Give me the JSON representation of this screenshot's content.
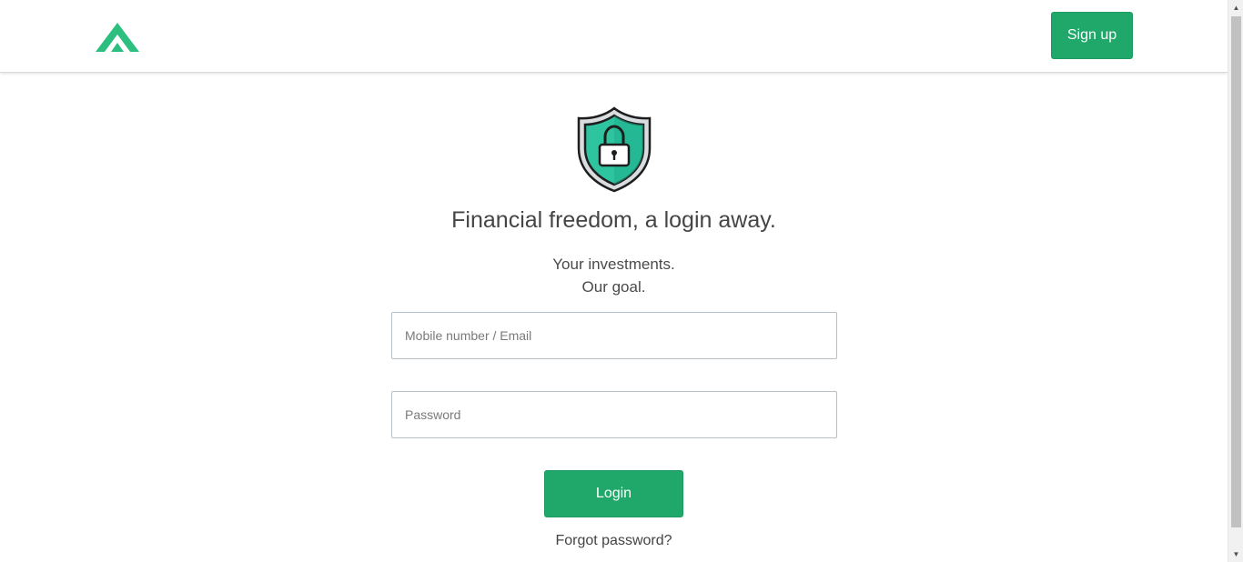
{
  "header": {
    "logo_icon": "mountain-chevron-logo",
    "signup_label": "Sign up"
  },
  "hero": {
    "icon": "shield-lock-icon",
    "headline": "Financial freedom, a login away.",
    "tagline_line1": "Your investments.",
    "tagline_line2": "Our goal."
  },
  "form": {
    "email_placeholder": "Mobile number / Email",
    "email_value": "",
    "password_placeholder": "Password",
    "password_value": "",
    "login_label": "Login",
    "forgot_label": "Forgot password?"
  },
  "colors": {
    "brand_green": "#20a86a",
    "shield_teal": "#2ec4a0",
    "text_dark": "#444444"
  }
}
